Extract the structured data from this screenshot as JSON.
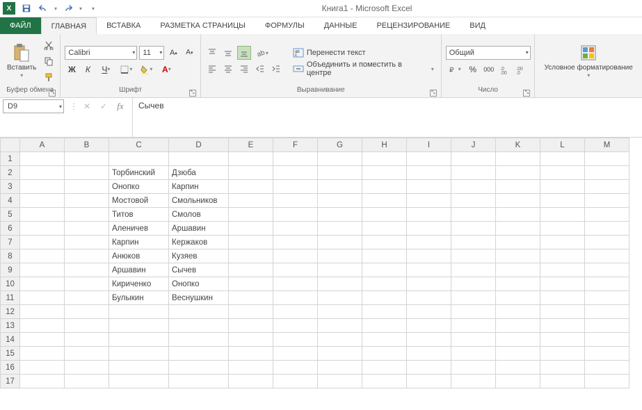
{
  "title": "Книга1 - Microsoft Excel",
  "tabs": {
    "file": "ФАЙЛ",
    "home": "ГЛАВНАЯ",
    "insert": "ВСТАВКА",
    "pagelayout": "РАЗМЕТКА СТРАНИЦЫ",
    "formulas": "ФОРМУЛЫ",
    "data": "ДАННЫЕ",
    "review": "РЕЦЕНЗИРОВАНИЕ",
    "view": "ВИД"
  },
  "ribbon": {
    "clipboard": {
      "paste": "Вставить",
      "label": "Буфер обмена"
    },
    "font": {
      "name": "Calibri",
      "size": "11",
      "label": "Шрифт",
      "bold": "Ж",
      "italic": "К",
      "underline": "Ч"
    },
    "alignment": {
      "wrap": "Перенести текст",
      "merge": "Объединить и поместить в центре",
      "label": "Выравнивание"
    },
    "number": {
      "format": "Общий",
      "label": "Число"
    },
    "styles": {
      "condfmt": "Условное форматирование"
    }
  },
  "namebox": "D9",
  "formula": "Сычев",
  "columns": [
    "A",
    "B",
    "C",
    "D",
    "E",
    "F",
    "G",
    "H",
    "I",
    "J",
    "K",
    "L",
    "M"
  ],
  "rows": [
    1,
    2,
    3,
    4,
    5,
    6,
    7,
    8,
    9,
    10,
    11,
    12,
    13,
    14,
    15,
    16,
    17
  ],
  "cells": {
    "2": {
      "C": "Торбинский",
      "D": "Дзюба"
    },
    "3": {
      "C": "Онопко",
      "D": "Карпин"
    },
    "4": {
      "C": "Мостовой",
      "D": "Смольников"
    },
    "5": {
      "C": "Титов",
      "D": "Смолов"
    },
    "6": {
      "C": "Аленичев",
      "D": "Аршавин"
    },
    "7": {
      "C": "Карпин",
      "D": "Кержаков"
    },
    "8": {
      "C": "Анюков",
      "D": "Кузяев"
    },
    "9": {
      "C": "Аршавин",
      "D": "Сычев"
    },
    "10": {
      "C": "Кириченко",
      "D": "Онопко"
    },
    "11": {
      "C": "Булыкин",
      "D": "Веснушкин"
    }
  }
}
